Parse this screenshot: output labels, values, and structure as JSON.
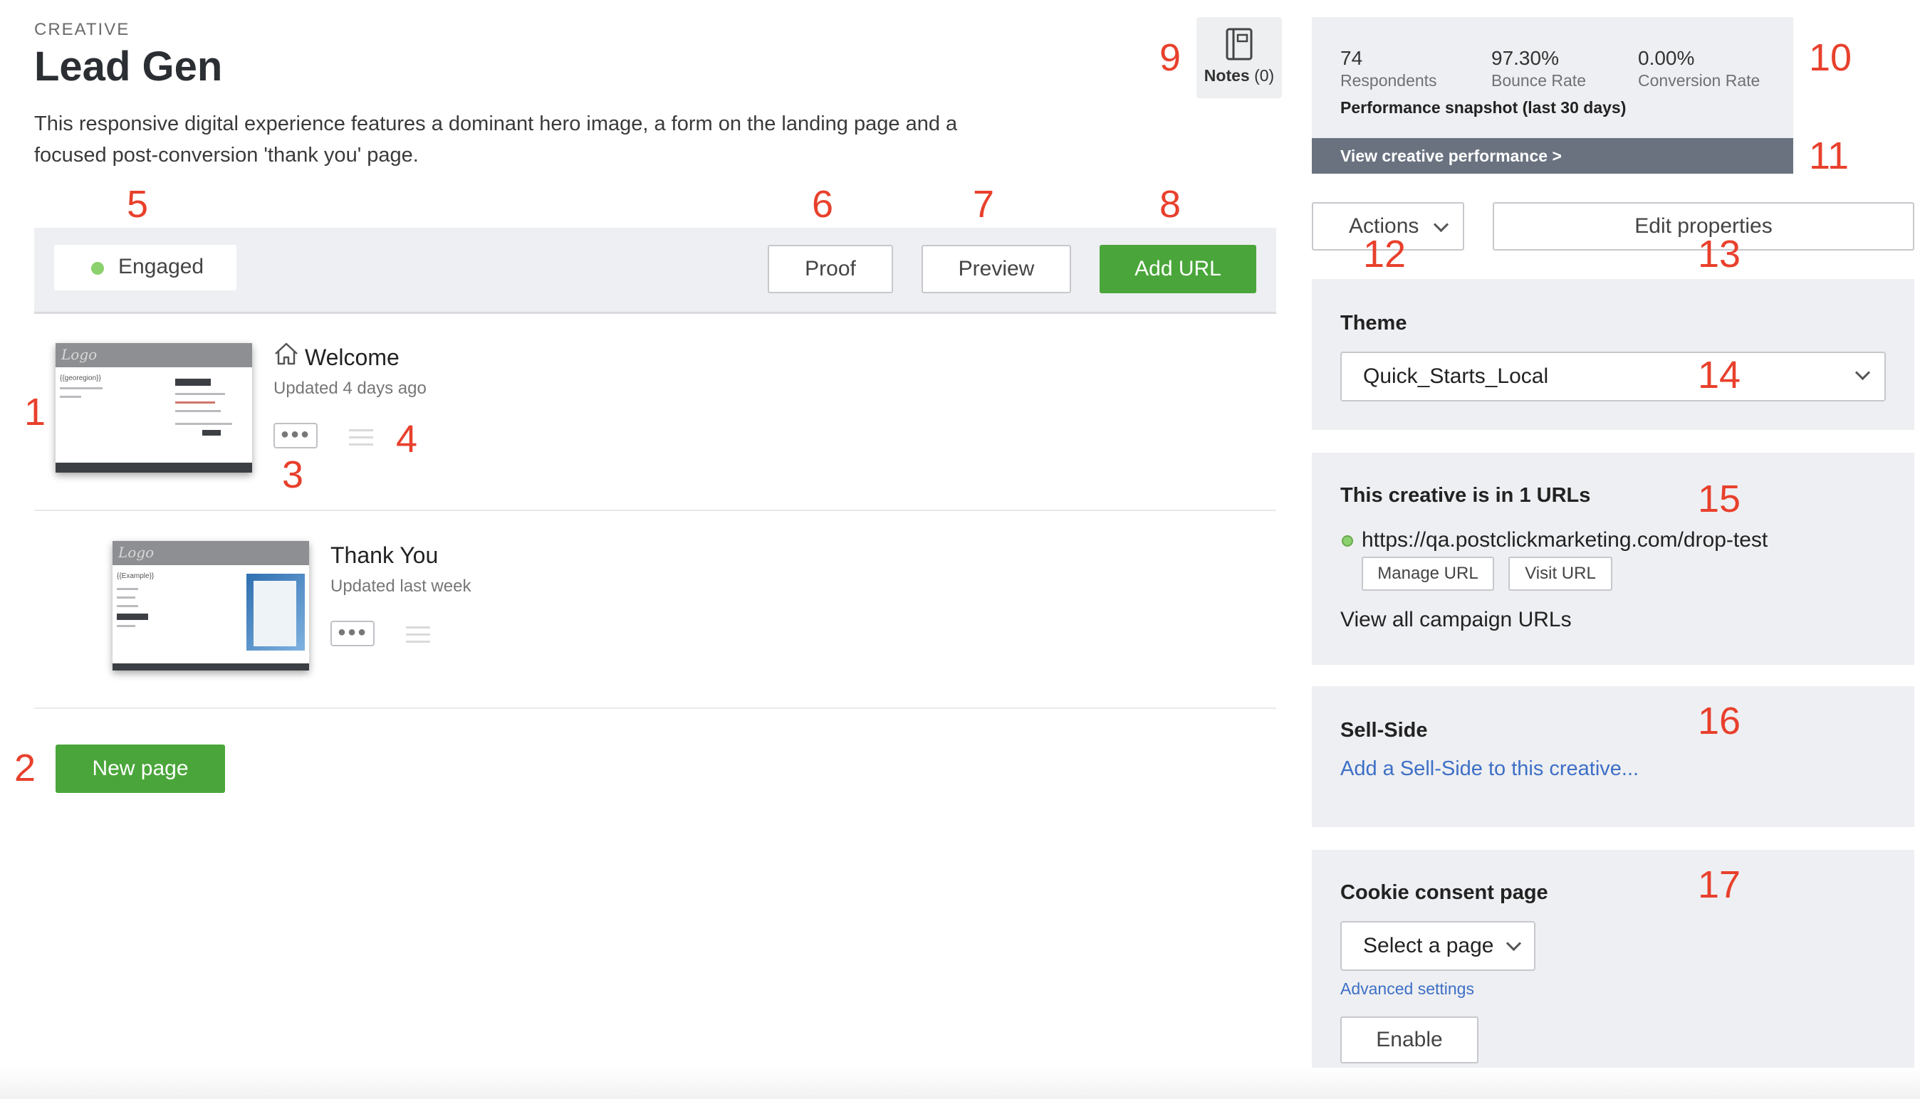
{
  "header": {
    "eyebrow": "CREATIVE",
    "title": "Lead Gen",
    "description": "This responsive digital experience features a dominant hero image, a form on the landing page and a focused post-conversion 'thank you' page.",
    "notes_label": "Notes",
    "notes_count": "(0)"
  },
  "toolbar": {
    "status_label": "Engaged",
    "status_color": "#8bd16e",
    "proof_label": "Proof",
    "preview_label": "Preview",
    "add_url_label": "Add URL"
  },
  "pages": [
    {
      "name": "Welcome",
      "updated": "Updated 4 days ago",
      "is_home": true,
      "thumb_logo": "Logo",
      "thumb_text": "{{georegion}}"
    },
    {
      "name": "Thank You",
      "updated": "Updated last week",
      "is_home": false,
      "thumb_logo": "Logo",
      "thumb_text": "{{Example}}"
    }
  ],
  "new_page_label": "New page",
  "performance": {
    "respondents_value": "74",
    "respondents_label": "Respondents",
    "bounce_value": "97.30%",
    "bounce_label": "Bounce Rate",
    "conversion_value": "0.00%",
    "conversion_label": "Conversion Rate",
    "caption": "Performance snapshot (last 30 days)",
    "link": "View creative performance >"
  },
  "actions_label": "Actions",
  "edit_properties_label": "Edit properties",
  "theme": {
    "title": "Theme",
    "selected": "Quick_Starts_Local"
  },
  "urls": {
    "title": "This creative is in 1 URLs",
    "url": "https://qa.postclickmarketing.com/drop-test",
    "manage_label": "Manage URL",
    "visit_label": "Visit URL",
    "view_all": "View all campaign URLs"
  },
  "sell_side": {
    "title": "Sell-Side",
    "link": "Add a Sell-Side to this creative..."
  },
  "cookie": {
    "title": "Cookie consent page",
    "select_placeholder": "Select a page",
    "advanced": "Advanced settings",
    "enable_label": "Enable"
  },
  "callouts": [
    "1",
    "2",
    "3",
    "4",
    "5",
    "6",
    "7",
    "8",
    "9",
    "10",
    "11",
    "12",
    "13",
    "14",
    "15",
    "16",
    "17"
  ],
  "colors": {
    "accent_green": "#4aa63a",
    "link_blue": "#3d6fc6",
    "callout_red": "#e8402c",
    "panel_bg": "#eeeff2"
  }
}
